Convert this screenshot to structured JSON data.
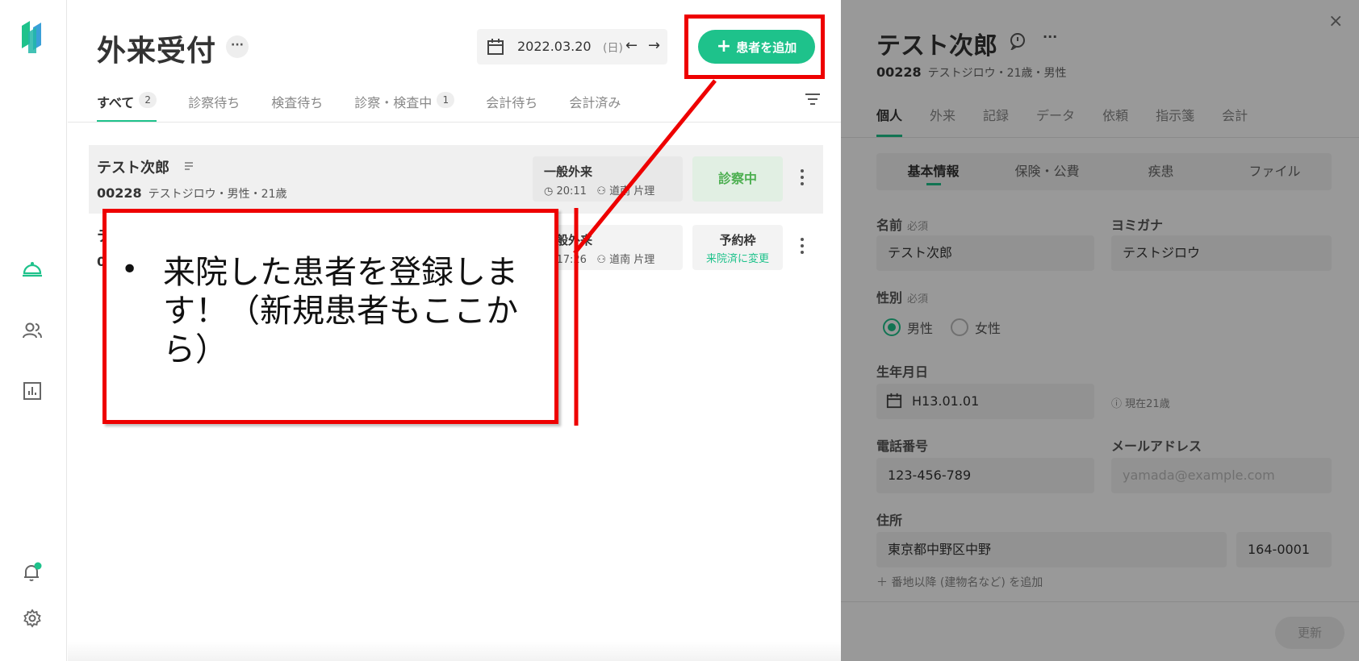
{
  "colors": {
    "accent": "#1ec28b",
    "annotation": "#ee0000",
    "in_progress": "#4caf50"
  },
  "main": {
    "title": "外来受付",
    "title_more": "···",
    "date": {
      "value": "2022.03.20",
      "weekday": "(日)",
      "prev": "←",
      "next": "→"
    },
    "add_patient": "患者を追加",
    "tabs": [
      {
        "label": "すべて",
        "count": "2"
      },
      {
        "label": "診察待ち"
      },
      {
        "label": "検査待ち"
      },
      {
        "label": "診察・検査中",
        "count": "1"
      },
      {
        "label": "会計待ち"
      },
      {
        "label": "会計済み"
      }
    ],
    "rows": [
      {
        "name": "テスト次郎",
        "id": "00228",
        "meta": "テストジロウ・男性・21歳",
        "visit_type": "一般外来",
        "time": "20:11",
        "doctor": "道南 片理",
        "status": "診察中"
      },
      {
        "name": "テ",
        "id": "0",
        "visit_type": "一般外来",
        "time": "17:26",
        "doctor": "道南 片理",
        "status": "予約枠",
        "status_action": "来院済に変更"
      }
    ]
  },
  "panel": {
    "title": "テスト次郎",
    "id": "00228",
    "meta": "テストジロウ・21歳・男性",
    "tabs": [
      "個人",
      "外来",
      "記録",
      "データ",
      "依頼",
      "指示箋",
      "会計"
    ],
    "subtabs": [
      "基本情報",
      "保険・公費",
      "疾患",
      "ファイル"
    ],
    "fields": {
      "name_label": "名前",
      "required": "必須",
      "name_value": "テスト次郎",
      "kana_label": "ヨミガナ",
      "kana_value": "テストジロウ",
      "sex_label": "性別",
      "male": "男性",
      "female": "女性",
      "birth_label": "生年月日",
      "birth_value": "H13.01.01",
      "age_note": "現在21歳",
      "phone_label": "電話番号",
      "phone_value": "123-456-789",
      "email_label": "メールアドレス",
      "email_placeholder": "yamada@example.com",
      "address_label": "住所",
      "address_value": "東京都中野区中野",
      "zip_value": "164-0001",
      "address_add": "番地以降 (建物名など) を追加"
    },
    "update": "更新",
    "close": "×"
  },
  "callout": {
    "bullet": "•",
    "text": "来院した患者を登録します！（新規患者もここから）"
  }
}
